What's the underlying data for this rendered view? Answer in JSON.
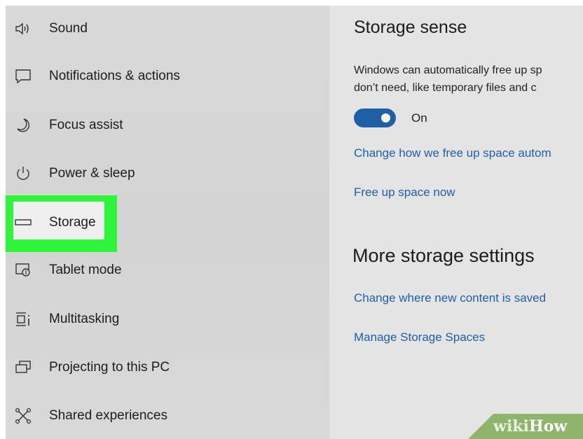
{
  "sidebar": {
    "items": [
      {
        "label": "Sound",
        "icon": "speaker-icon"
      },
      {
        "label": "Notifications & actions",
        "icon": "message-icon"
      },
      {
        "label": "Focus assist",
        "icon": "moon-icon"
      },
      {
        "label": "Power & sleep",
        "icon": "power-icon"
      },
      {
        "label": "Storage",
        "icon": "storage-icon",
        "selected": true
      },
      {
        "label": "Tablet mode",
        "icon": "tablet-icon"
      },
      {
        "label": "Multitasking",
        "icon": "multitasking-icon"
      },
      {
        "label": "Projecting to this PC",
        "icon": "projecting-icon"
      },
      {
        "label": "Shared experiences",
        "icon": "shared-experiences-icon"
      }
    ]
  },
  "main": {
    "storage_sense": {
      "title": "Storage sense",
      "description_line1": "Windows can automatically free up sp",
      "description_line2": "don’t need, like temporary files and c",
      "toggle_state": "On",
      "toggle_on": true,
      "link_change_how": "Change how we free up space autom",
      "link_free_up": "Free up space now"
    },
    "more_settings": {
      "title": "More storage settings",
      "link_change_where": "Change where new content is saved",
      "link_manage_spaces": "Manage Storage Spaces"
    }
  },
  "watermark": {
    "part1": "wiki",
    "part2": "How"
  },
  "colors": {
    "accent": "#1f5fa8",
    "highlight": "#2ff53a",
    "sidebar_bg": "#d6d6d6",
    "main_bg": "#e4e4e4"
  }
}
